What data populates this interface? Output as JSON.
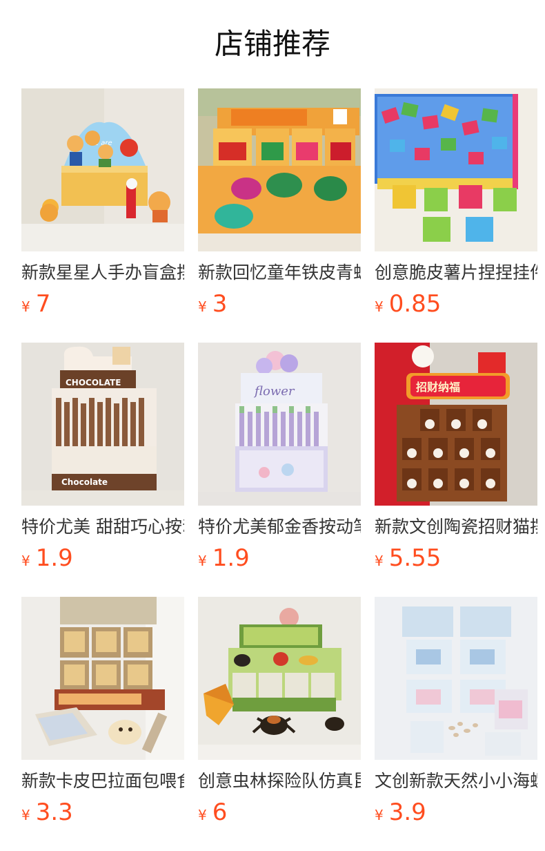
{
  "page": {
    "title": "店铺推荐",
    "accent_color": "#ff4d1f"
  },
  "products": [
    {
      "name": "新款星星人手办盲盒摆件",
      "currency": "¥",
      "price": "7",
      "icon": "figurine-blind-box-image"
    },
    {
      "name": "新款回忆童年铁皮青蛙",
      "currency": "¥",
      "price": "3",
      "icon": "tin-toy-frog-image"
    },
    {
      "name": "创意脆皮薯片捏捏挂件",
      "currency": "¥",
      "price": "0.85",
      "icon": "chips-squeeze-toy-image"
    },
    {
      "name": "特价尤美 甜甜巧心按动笔",
      "currency": "¥",
      "price": "1.9",
      "icon": "chocolate-pen-box-image"
    },
    {
      "name": "特价尤美郁金香按动笔",
      "currency": "¥",
      "price": "1.9",
      "icon": "flower-pen-box-image"
    },
    {
      "name": "新款文创陶瓷招财猫摆件",
      "currency": "¥",
      "price": "5.55",
      "icon": "lucky-cat-shelf-image"
    },
    {
      "name": "新款卡皮巴拉面包喂食玩具",
      "currency": "¥",
      "price": "3.3",
      "icon": "capybara-bread-toy-image"
    },
    {
      "name": "创意虫林探险队仿真昆虫",
      "currency": "¥",
      "price": "6",
      "icon": "insect-model-toy-image"
    },
    {
      "name": "文创新款天然小小海螺",
      "currency": "¥",
      "price": "3.9",
      "icon": "seashell-box-image"
    }
  ]
}
